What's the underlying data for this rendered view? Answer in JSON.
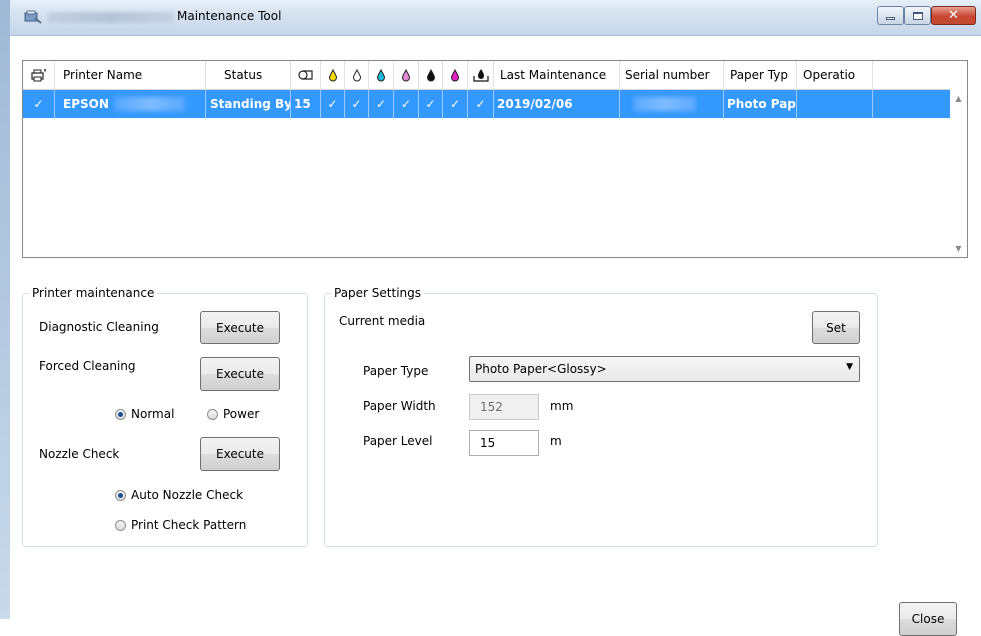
{
  "window": {
    "title": "Maintenance Tool",
    "close_symbol": "✕"
  },
  "grid": {
    "columns": [
      {
        "key": "printer_icon",
        "label": ""
      },
      {
        "key": "printer_name",
        "label": "Printer Name"
      },
      {
        "key": "status",
        "label": "Status"
      },
      {
        "key": "paper_icon",
        "label": ""
      },
      {
        "key": "ink1",
        "label": ""
      },
      {
        "key": "ink2",
        "label": ""
      },
      {
        "key": "ink3",
        "label": ""
      },
      {
        "key": "ink4",
        "label": ""
      },
      {
        "key": "ink5",
        "label": ""
      },
      {
        "key": "ink6",
        "label": ""
      },
      {
        "key": "waste",
        "label": ""
      },
      {
        "key": "last_maintenance",
        "label": "Last Maintenance"
      },
      {
        "key": "serial_number",
        "label": "Serial number"
      },
      {
        "key": "paper_type",
        "label": "Paper Typ"
      },
      {
        "key": "operation",
        "label": "Operatio"
      }
    ],
    "ink_colors": [
      "#f2d900",
      "#ffffff",
      "#1fb8d6",
      "#e48ad6",
      "#111111",
      "#e020c0"
    ],
    "rows": [
      {
        "selected_check": "✓",
        "printer_name": "EPSON",
        "status": "Standing By",
        "paper_remaining": "15",
        "ink_checks": [
          "✓",
          "✓",
          "✓",
          "✓",
          "✓",
          "✓",
          "✓"
        ],
        "last_maintenance": "2019/02/06",
        "paper_type": "Photo Pap",
        "operation": ""
      }
    ]
  },
  "printer_maintenance": {
    "legend": "Printer maintenance",
    "diagnostic_cleaning_label": "Diagnostic Cleaning",
    "forced_cleaning_label": "Forced Cleaning",
    "nozzle_check_label": "Nozzle Check",
    "execute_label": "Execute",
    "radio_normal": "Normal",
    "radio_power": "Power",
    "radio_auto_nozzle": "Auto Nozzle Check",
    "radio_print_pattern": "Print Check Pattern",
    "cleaning_mode_selected": "Normal",
    "nozzle_mode_selected": "Auto Nozzle Check"
  },
  "paper_settings": {
    "legend": "Paper Settings",
    "current_media_label": "Current media",
    "set_label": "Set",
    "paper_type_label": "Paper Type",
    "paper_type_value": "Photo Paper<Glossy>",
    "paper_width_label": "Paper Width",
    "paper_width_value": "152",
    "paper_width_unit": "mm",
    "paper_level_label": "Paper Level",
    "paper_level_value": "15",
    "paper_level_unit": "m"
  },
  "footer": {
    "close_label": "Close"
  }
}
